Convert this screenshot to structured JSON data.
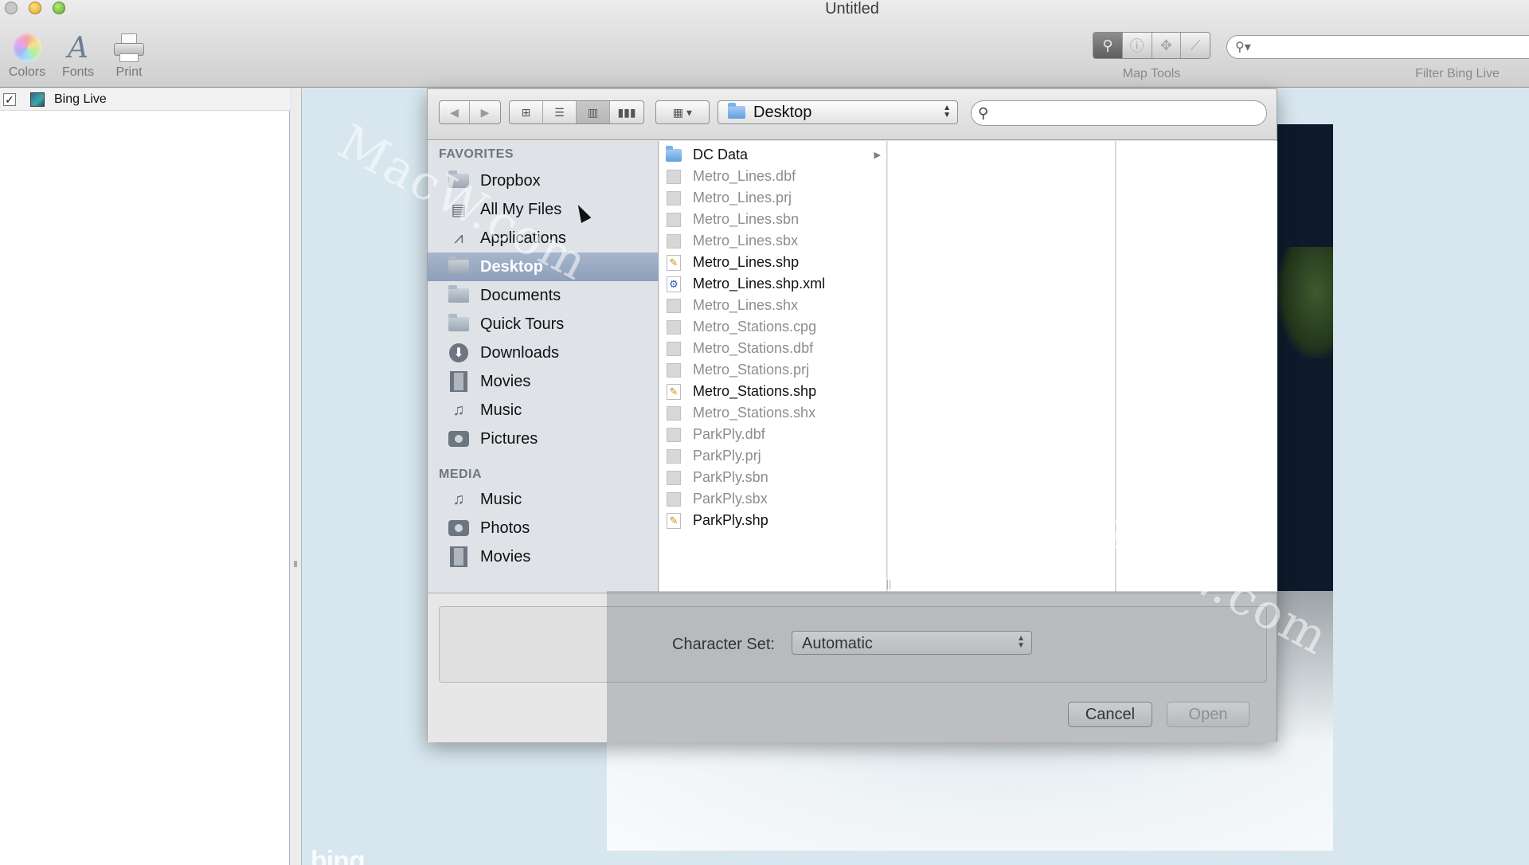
{
  "window": {
    "title": "Untitled"
  },
  "toolbar": {
    "colors_label": "Colors",
    "fonts_label": "Fonts",
    "print_label": "Print",
    "map_tools_label": "Map Tools",
    "map_tools": [
      {
        "icon": "magnifier-icon",
        "active": true
      },
      {
        "icon": "info-icon",
        "active": false
      },
      {
        "icon": "pan-icon",
        "active": false
      },
      {
        "icon": "measure-icon",
        "active": false
      }
    ],
    "filter_label": "Filter Bing Live",
    "filter_value": ""
  },
  "layers": [
    {
      "name": "Bing Live",
      "checked": true,
      "check_glyph": "✓"
    }
  ],
  "dialog": {
    "location": "Desktop",
    "search_value": "",
    "favorites_header": "FAVORITES",
    "favorites": [
      {
        "label": "Dropbox",
        "icon": "folder-icon"
      },
      {
        "label": "All My Files",
        "icon": "all-files-icon"
      },
      {
        "label": "Applications",
        "icon": "applications-icon"
      },
      {
        "label": "Desktop",
        "icon": "desktop-icon",
        "selected": true
      },
      {
        "label": "Documents",
        "icon": "documents-icon"
      },
      {
        "label": "Quick Tours",
        "icon": "folder-icon"
      },
      {
        "label": "Downloads",
        "icon": "downloads-icon"
      },
      {
        "label": "Movies",
        "icon": "movies-icon"
      },
      {
        "label": "Music",
        "icon": "music-icon"
      },
      {
        "label": "Pictures",
        "icon": "pictures-icon"
      }
    ],
    "media_header": "MEDIA",
    "media": [
      {
        "label": "Music",
        "icon": "music-icon"
      },
      {
        "label": "Photos",
        "icon": "photos-icon"
      },
      {
        "label": "Movies",
        "icon": "movies-icon"
      }
    ],
    "files": [
      {
        "name": "DC Data",
        "kind": "folder",
        "enabled": true
      },
      {
        "name": "Metro_Lines.dbf",
        "kind": "doc",
        "enabled": false
      },
      {
        "name": "Metro_Lines.prj",
        "kind": "doc",
        "enabled": false
      },
      {
        "name": "Metro_Lines.sbn",
        "kind": "doc",
        "enabled": false
      },
      {
        "name": "Metro_Lines.sbx",
        "kind": "doc",
        "enabled": false
      },
      {
        "name": "Metro_Lines.shp",
        "kind": "shp",
        "enabled": true
      },
      {
        "name": "Metro_Lines.shp.xml",
        "kind": "xml",
        "enabled": true
      },
      {
        "name": "Metro_Lines.shx",
        "kind": "doc",
        "enabled": false
      },
      {
        "name": "Metro_Stations.cpg",
        "kind": "doc",
        "enabled": false
      },
      {
        "name": "Metro_Stations.dbf",
        "kind": "doc",
        "enabled": false
      },
      {
        "name": "Metro_Stations.prj",
        "kind": "doc",
        "enabled": false
      },
      {
        "name": "Metro_Stations.shp",
        "kind": "shp",
        "enabled": true
      },
      {
        "name": "Metro_Stations.shx",
        "kind": "doc",
        "enabled": false
      },
      {
        "name": "ParkPly.dbf",
        "kind": "doc",
        "enabled": false
      },
      {
        "name": "ParkPly.prj",
        "kind": "doc",
        "enabled": false
      },
      {
        "name": "ParkPly.sbn",
        "kind": "doc",
        "enabled": false
      },
      {
        "name": "ParkPly.sbx",
        "kind": "doc",
        "enabled": false
      },
      {
        "name": "ParkPly.shp",
        "kind": "shp",
        "enabled": true
      }
    ],
    "charset_label": "Character Set:",
    "charset_value": "Automatic",
    "cancel_label": "Cancel",
    "open_label": "Open"
  },
  "map": {
    "logo_text": "bing"
  },
  "watermark": "MacW.com"
}
